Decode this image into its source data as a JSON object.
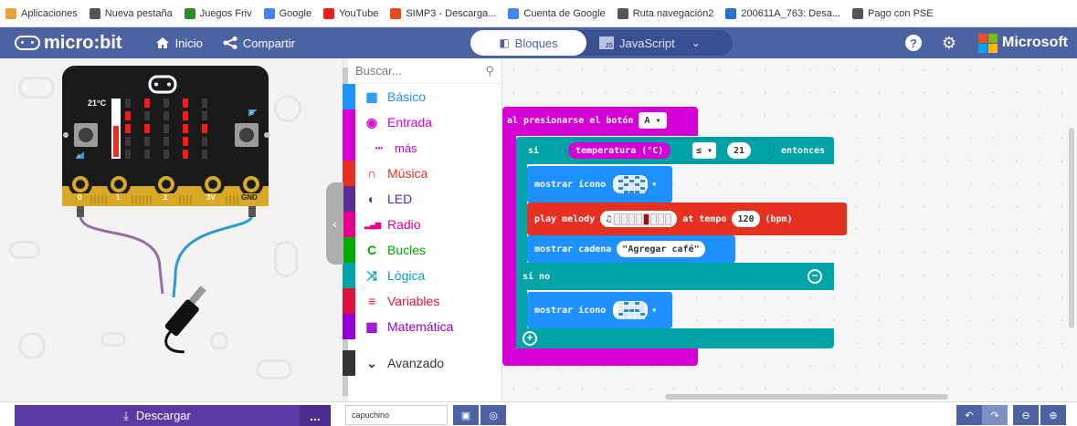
{
  "bookmarks": [
    {
      "label": "Aplicaciones",
      "icon": "apps-grid-icon",
      "color": "#e8a33a"
    },
    {
      "label": "Nueva pestaña",
      "icon": "globe-icon",
      "color": "#555555"
    },
    {
      "label": "Juegos Friv",
      "icon": "friv-icon",
      "color": "#2c8c2c"
    },
    {
      "label": "Google",
      "icon": "google-icon",
      "color": "#4285f4"
    },
    {
      "label": "YouTube",
      "icon": "youtube-icon",
      "color": "#e62117"
    },
    {
      "label": "SIMP3 - Descarga...",
      "icon": "simp3-icon",
      "color": "#e84a1a"
    },
    {
      "label": "Cuenta de Google",
      "icon": "google-icon",
      "color": "#4285f4"
    },
    {
      "label": "Ruta navegación2",
      "icon": "globe-icon",
      "color": "#555555"
    },
    {
      "label": "200611A_763: Desa...",
      "icon": "doc-icon",
      "color": "#2a72c9"
    },
    {
      "label": "Pago con PSE",
      "icon": "globe-icon",
      "color": "#555555"
    }
  ],
  "menubar": {
    "logo": "micro:bit",
    "home": "Inicio",
    "share": "Compartir",
    "mode_blocks": "Bloques",
    "mode_js": "JavaScript",
    "js_badge": "JS",
    "brand": "Microsoft",
    "help_icon": "help-icon",
    "settings_icon": "gear-icon"
  },
  "simulator": {
    "temperature": "21°C",
    "button_a": "A",
    "button_b": "B",
    "pins": [
      "0",
      "1",
      "2",
      "3V",
      "GND"
    ],
    "led_matrix": [
      [
        0,
        1,
        0,
        1,
        0
      ],
      [
        1,
        0,
        0,
        1,
        0
      ],
      [
        1,
        1,
        0,
        1,
        1
      ],
      [
        0,
        0,
        0,
        1,
        0
      ],
      [
        0,
        0,
        0,
        1,
        0
      ]
    ]
  },
  "toolbox": {
    "search_placeholder": "Buscar...",
    "categories": [
      {
        "label": "Básico",
        "color": "#1e90ff",
        "icon": "grid-icon",
        "glyph": "▦"
      },
      {
        "label": "Entrada",
        "color": "#d400d4",
        "icon": "target-icon",
        "glyph": "◉"
      },
      {
        "label": "más",
        "color": "#d400d4",
        "icon": "more-dots-icon",
        "glyph": "•••"
      },
      {
        "label": "Música",
        "color": "#e63022",
        "icon": "headphones-icon",
        "glyph": "∩"
      },
      {
        "label": "LED",
        "color": "#5c2d91",
        "icon": "toggle-icon",
        "glyph": "◐"
      },
      {
        "label": "Radio",
        "color": "#e3008c",
        "icon": "signal-bars-icon",
        "glyph": "▂▄▆"
      },
      {
        "label": "Bucles",
        "color": "#00aa00",
        "icon": "loop-icon",
        "glyph": "C"
      },
      {
        "label": "Lógica",
        "color": "#00a4a6",
        "icon": "shuffle-icon",
        "glyph": "⤨"
      },
      {
        "label": "Variables",
        "color": "#dc143c",
        "icon": "list-icon",
        "glyph": "≡"
      },
      {
        "label": "Matemática",
        "color": "#9400d3",
        "icon": "calculator-icon",
        "glyph": "▦"
      },
      {
        "label": "Avanzado",
        "color": "#333333",
        "icon": "chevron-down-icon",
        "glyph": "⌄"
      }
    ]
  },
  "workspace": {
    "event": {
      "label": "al presionarse el botón",
      "button": "A"
    },
    "if": {
      "label": "si",
      "sensor": "temperatura (°C)",
      "operator": "≤",
      "value": "21",
      "then": "entonces"
    },
    "show_icon": "mostrar ícono",
    "play": {
      "label": "play melody",
      "tempo_label": "at tempo",
      "tempo": "120",
      "unit": "(bpm)"
    },
    "show_string": {
      "label": "mostrar cadena",
      "value": "\"Agregar café\""
    },
    "else_label": "si no",
    "colors": {
      "event": "#d400d4",
      "logic": "#00a4a6",
      "basic": "#1e90ff",
      "music": "#e63022",
      "input": "#d400d4"
    }
  },
  "bottom": {
    "download": "Descargar",
    "more": "...",
    "project_name": "capuchino"
  }
}
